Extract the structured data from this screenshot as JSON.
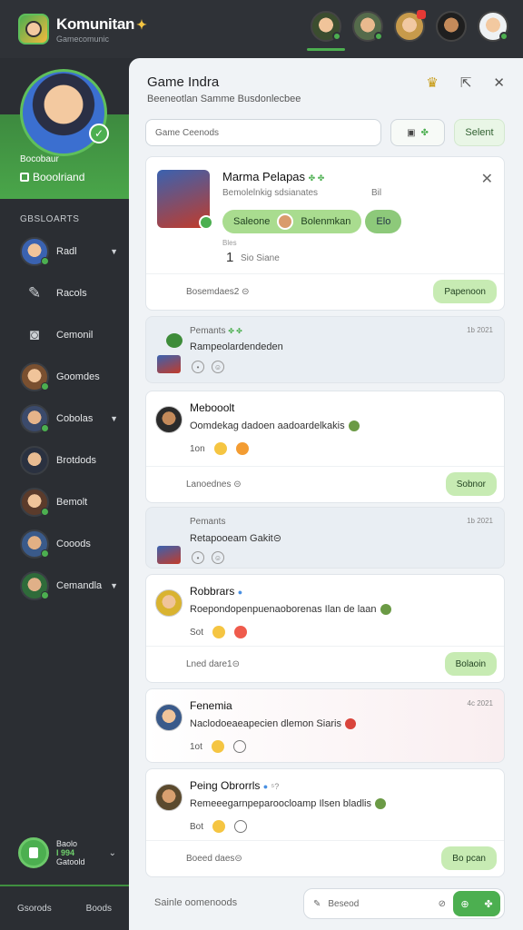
{
  "app": {
    "title": "Komunitan",
    "subtitle": "Gamecomunic"
  },
  "top_avatars": [
    "avatar-1",
    "avatar-2",
    "avatar-3",
    "avatar-4",
    "avatar-5"
  ],
  "profile": {
    "name": "Bocobaur",
    "status": "Booolriand"
  },
  "sidebar": {
    "section_label": "GBSLOARTS",
    "items": [
      {
        "label": "Radl",
        "icon": "avatar",
        "chev": "▼"
      },
      {
        "label": "Racols",
        "icon": "pencil-icon",
        "chev": ""
      },
      {
        "label": "Cemonil",
        "icon": "camera-icon",
        "chev": ""
      },
      {
        "label": "Goomdes",
        "icon": "avatar",
        "chev": ""
      },
      {
        "label": "Cobolas",
        "icon": "avatar",
        "chev": "▼"
      },
      {
        "label": "Brotdods",
        "icon": "avatar",
        "chev": ""
      },
      {
        "label": "Bemolt",
        "icon": "avatar",
        "chev": ""
      },
      {
        "label": "Cooods",
        "icon": "avatar",
        "chev": ""
      },
      {
        "label": "Cemandla",
        "icon": "avatar",
        "chev": "▼"
      }
    ],
    "bottom": {
      "line1": "Baolo",
      "line2": "I 994",
      "line3": "Gatoold"
    },
    "footer": {
      "left": "Gsorods",
      "right": "Boods"
    }
  },
  "main": {
    "title": "Game Indra",
    "subtitle": "Beeneotlan Samme Busdonlecbee",
    "search_placeholder": "Game Ceenods",
    "select_label": "Selent",
    "featured": {
      "name": "Marma Pelapas",
      "desc": "Bemolelnkig sdsianates",
      "desc2": "Bil",
      "pill1": "Saleone",
      "pill2": "Bolenmkan",
      "pill3": "Elo",
      "meta": "Bles",
      "count": "1",
      "count_label": "Sio Siane",
      "foot_label": "Bosemdaes2 ⊝",
      "foot_button": "Papenoon"
    },
    "activities": [
      {
        "title": "Pemants",
        "time": "1b 2021",
        "text": "Rampeolardendeden"
      },
      {
        "title": "Pemants",
        "time": "1b 2021",
        "text": "Retapooeam Gakit⊝"
      }
    ],
    "posts": [
      {
        "name": "Mebooolt",
        "time": "",
        "text": "Oomdekag dadoen aadoardelkakis",
        "reacts": "1on",
        "foot_label": "Lanoednes ⊝",
        "foot_button": "Sobnor"
      },
      {
        "name": "Robbrars",
        "time": "",
        "text": "Roepondopenpuenaoborenas Ilan de laan",
        "reacts": "Sot",
        "foot_label": "Lned dare1⊝",
        "foot_button": "Bolaoin"
      },
      {
        "name": "Fenemia",
        "time": "4c 2021",
        "text": "Naclodoeaeapecien dlemon Siaris",
        "reacts": "1ot",
        "foot_label": "",
        "foot_button": ""
      },
      {
        "name": "Peing Obrorrls",
        "time": "",
        "text": "Remeeegarnpeparoocloamp Ilsen bladlis",
        "reacts": "Bot",
        "foot_label": "Boeed daes⊝",
        "foot_button": "Bo pcan"
      }
    ],
    "bottom_label": "Sainle oomenoods",
    "compose_placeholder": "Beseod"
  }
}
